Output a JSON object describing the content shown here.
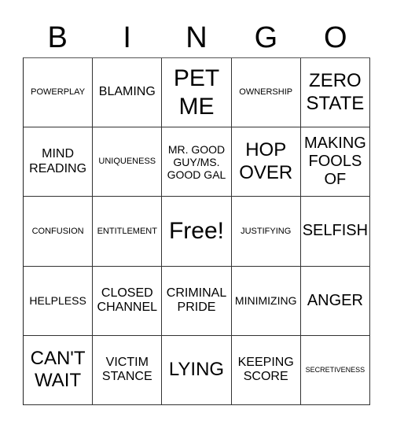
{
  "header": {
    "letters": [
      "B",
      "I",
      "N",
      "G",
      "O"
    ]
  },
  "grid": {
    "rows": [
      [
        "POWERPLAY",
        "BLAMING",
        "PET ME",
        "OWNERSHIP",
        "ZERO STATE"
      ],
      [
        "MIND READING",
        "UNIQUENESS",
        "MR. GOOD GUY/MS. GOOD GAL",
        "HOP OVER",
        "MAKING FOOLS OF"
      ],
      [
        "CONFUSION",
        "ENTITLEMENT",
        "Free!",
        "JUSTIFYING",
        "SELFISH"
      ],
      [
        "HELPLESS",
        "CLOSED CHANNEL",
        "CRIMINAL PRIDE",
        "MINIMIZING",
        "ANGER"
      ],
      [
        "CAN'T WAIT",
        "VICTIM STANCE",
        "LYING",
        "KEEPING SCORE",
        "SECRETIVENESS"
      ]
    ],
    "free_space": "Free!"
  }
}
